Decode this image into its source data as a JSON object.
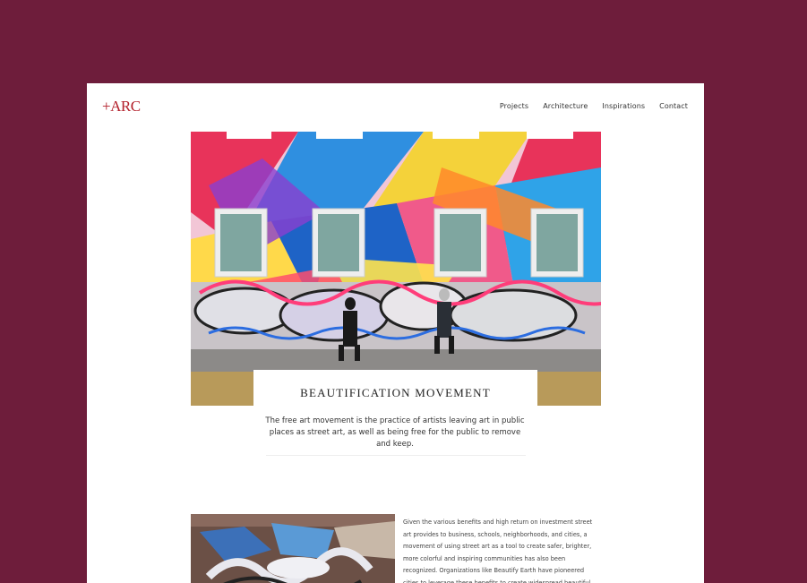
{
  "brand": {
    "logo": "+ARC"
  },
  "nav": {
    "items": [
      {
        "label": "Projects"
      },
      {
        "label": "Architecture"
      },
      {
        "label": "Inspirations"
      },
      {
        "label": "Contact"
      }
    ]
  },
  "feature": {
    "title": "BEAUTIFICATION MOVEMENT",
    "text": "The free art movement is the practice of artists leaving art in public places as street art, as well as being free for the public to remove and keep."
  },
  "article": {
    "text": "Given the various benefits and high return on investment street art provides to business, schools, neighborhoods, and cities, a movement of using street art as a tool to create safer, brighter, more colorful and inspiring communities has also been recognized. Organizations like Beautify Earth have pioneered cities to leverage these benefits to create widespread beautiful"
  },
  "colors": {
    "frame": "#6e1d3b",
    "accent": "#b3202b"
  }
}
